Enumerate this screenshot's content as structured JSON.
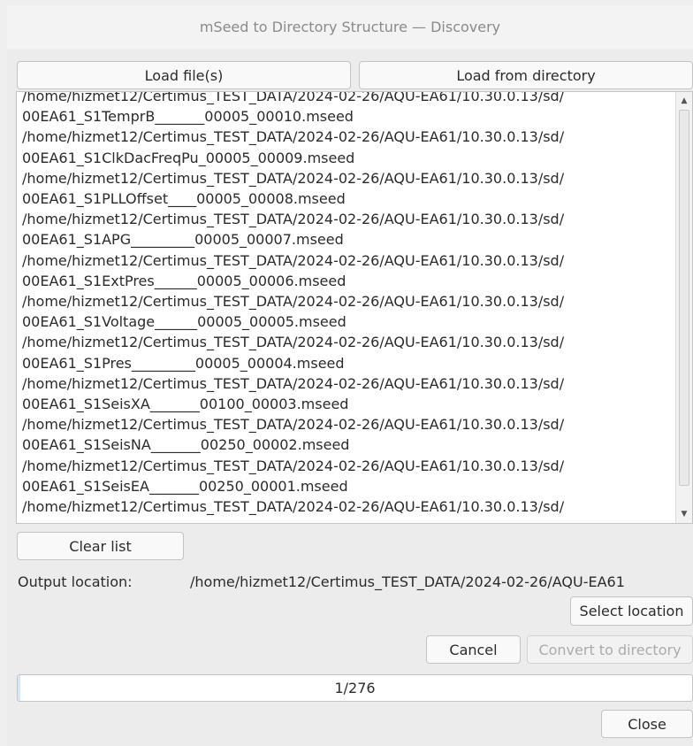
{
  "window": {
    "title": "mSeed to Directory Structure — Discovery"
  },
  "toolbar": {
    "load_files_label": "Load file(s)",
    "load_directory_label": "Load from directory"
  },
  "file_list": {
    "items": [
      {
        "path": "/home/hizmet12/Certimus_TEST_DATA/2024-02-26/AQU-EA61/10.30.0.13/sd/",
        "file": "00EA61_S1TemprB_______00005_00010.mseed"
      },
      {
        "path": "/home/hizmet12/Certimus_TEST_DATA/2024-02-26/AQU-EA61/10.30.0.13/sd/",
        "file": "00EA61_S1ClkDacFreqPu_00005_00009.mseed"
      },
      {
        "path": "/home/hizmet12/Certimus_TEST_DATA/2024-02-26/AQU-EA61/10.30.0.13/sd/",
        "file": "00EA61_S1PLLOffset____00005_00008.mseed"
      },
      {
        "path": "/home/hizmet12/Certimus_TEST_DATA/2024-02-26/AQU-EA61/10.30.0.13/sd/",
        "file": "00EA61_S1APG_________00005_00007.mseed"
      },
      {
        "path": "/home/hizmet12/Certimus_TEST_DATA/2024-02-26/AQU-EA61/10.30.0.13/sd/",
        "file": "00EA61_S1ExtPres______00005_00006.mseed"
      },
      {
        "path": "/home/hizmet12/Certimus_TEST_DATA/2024-02-26/AQU-EA61/10.30.0.13/sd/",
        "file": "00EA61_S1Voltage______00005_00005.mseed"
      },
      {
        "path": "/home/hizmet12/Certimus_TEST_DATA/2024-02-26/AQU-EA61/10.30.0.13/sd/",
        "file": "00EA61_S1Pres_________00005_00004.mseed"
      },
      {
        "path": "/home/hizmet12/Certimus_TEST_DATA/2024-02-26/AQU-EA61/10.30.0.13/sd/",
        "file": "00EA61_S1SeisXA_______00100_00003.mseed"
      },
      {
        "path": "/home/hizmet12/Certimus_TEST_DATA/2024-02-26/AQU-EA61/10.30.0.13/sd/",
        "file": "00EA61_S1SeisNA_______00250_00002.mseed"
      },
      {
        "path": "/home/hizmet12/Certimus_TEST_DATA/2024-02-26/AQU-EA61/10.30.0.13/sd/",
        "file": "00EA61_S1SeisEA_______00250_00001.mseed"
      },
      {
        "path": "/home/hizmet12/Certimus_TEST_DATA/2024-02-26/AQU-EA61/10.30.0.13/sd/",
        "file": ""
      }
    ],
    "scroll_up_icon": "arrow-up-icon",
    "scroll_down_icon": "arrow-down-icon"
  },
  "actions": {
    "clear_list_label": "Clear list",
    "output_location_label": "Output location:",
    "output_location_value": "/home/hizmet12/Certimus_TEST_DATA/2024-02-26/AQU-EA61",
    "select_location_label": "Select location",
    "cancel_label": "Cancel",
    "convert_label": "Convert to directory",
    "close_label": "Close"
  },
  "progress": {
    "text": "1/276",
    "fraction": 0.0036
  },
  "colors": {
    "window_bg": "#efefef",
    "progress_fill": "#d9e6f5",
    "disabled_text": "#ababab"
  }
}
